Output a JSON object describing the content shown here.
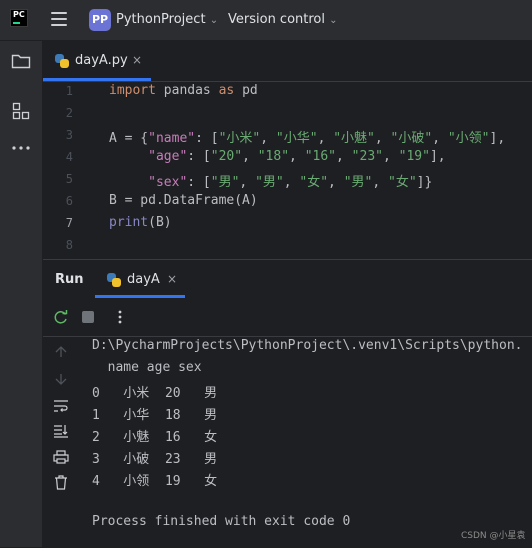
{
  "window": {
    "app_logo_text": "PC",
    "project_badge": "PP",
    "project_name": "PythonProject",
    "version_control": "Version control"
  },
  "editor_tab": {
    "label": "dayA.py",
    "close": "×"
  },
  "editor": {
    "line_numbers": [
      "1",
      "2",
      "3",
      "4",
      "5",
      "6",
      "7",
      "8"
    ],
    "lines": [
      {
        "kw": "import",
        "p1": " pandas ",
        "kw2": "as",
        "p2": " pd"
      },
      {},
      {
        "p1": "A = {",
        "s1": "\"name\"",
        "p2": ": [",
        "s2": "\"小米\"",
        "c1": ", ",
        "s3": "\"小华\"",
        "c2": ", ",
        "s4": "\"小魅\"",
        "c3": ", ",
        "s5": "\"小破\"",
        "c4": ", ",
        "s6": "\"小领\"",
        "p3": "],"
      },
      {
        "p1": "     ",
        "s1": "\"age\"",
        "p2": ": [",
        "s2": "\"20\"",
        "c1": ", ",
        "s3": "\"18\"",
        "c2": ", ",
        "s4": "\"16\"",
        "c3": ", ",
        "s5": "\"23\"",
        "c4": ", ",
        "s6": "\"19\"",
        "p3": "],"
      },
      {
        "p1": "     ",
        "s1": "\"sex\"",
        "p2": ": [",
        "s2": "\"男\"",
        "c1": ", ",
        "s3": "\"男\"",
        "c2": ", ",
        "s4": "\"女\"",
        "c3": ", ",
        "s5": "\"男\"",
        "c4": ", ",
        "s6": "\"女\"",
        "p3": "]}"
      },
      {
        "p1": "B = pd.DataFrame(A)"
      },
      {
        "bi": "print",
        "p1": "(B)"
      },
      {}
    ]
  },
  "run_panel": {
    "title": "Run",
    "tab_label": "dayA",
    "tab_close": "×",
    "console": {
      "command": "D:\\PycharmProjects\\PythonProject\\.venv1\\Scripts\\python.",
      "header": "  name age sex",
      "rows": [
        "0   小米  20   男",
        "1   小华  18   男",
        "2   小魅  16   女",
        "3   小破  23   男",
        "4   小领  19   女"
      ],
      "exit": "Process finished with exit code 0"
    }
  },
  "watermark": "CSDN @小星袁",
  "colors": {
    "accent": "#3574f0",
    "keyword": "#cf8e6d",
    "string": "#6aab73",
    "dict_key": "#c77dbb",
    "builtin": "#8888c6"
  },
  "icons": [
    "jetbrains-pc-logo-icon",
    "hamburger-menu-icon",
    "folder-icon",
    "structure-icon",
    "more-icon",
    "python-file-icon",
    "rerun-icon",
    "stop-icon",
    "kebab-menu-icon",
    "scroll-up-icon",
    "scroll-down-icon",
    "soft-wrap-icon",
    "scroll-to-end-icon",
    "print-icon",
    "trash-icon"
  ]
}
